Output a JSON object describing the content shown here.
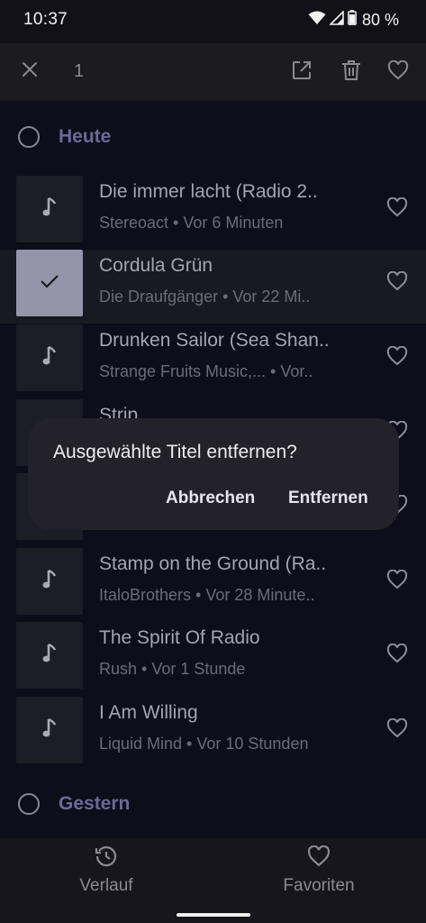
{
  "status_bar": {
    "time": "10:37",
    "battery": "80 %"
  },
  "top_bar": {
    "selected_count": "1",
    "actions": [
      "open-external-icon",
      "delete-icon",
      "heart-icon"
    ]
  },
  "sections": [
    {
      "label": "Heute"
    },
    {
      "label": "Gestern"
    }
  ],
  "tracks": [
    {
      "title": "Die immer lacht (Radio 2..",
      "subtitle": "Stereoact • Vor 6 Minuten",
      "selected": false
    },
    {
      "title": "Cordula Grün",
      "subtitle": "Die Draufgänger • Vor 22 Mi..",
      "selected": true
    },
    {
      "title": "Drunken Sailor (Sea Shan..",
      "subtitle": "Strange Fruits Music,... • Vor..",
      "selected": false
    },
    {
      "title": "Strip",
      "subtitle": "",
      "selected": false
    },
    {
      "title": "",
      "subtitle": "",
      "selected": false
    },
    {
      "title": "Stamp on the Ground (Ra..",
      "subtitle": "ItaloBrothers • Vor 28 Minute..",
      "selected": false
    },
    {
      "title": "The Spirit Of Radio",
      "subtitle": "Rush • Vor 1 Stunde",
      "selected": false
    },
    {
      "title": "I Am Willing",
      "subtitle": "Liquid Mind • Vor 10 Stunden",
      "selected": false
    }
  ],
  "dialog": {
    "title": "Ausgewählte Titel entfernen?",
    "cancel_label": "Abbrechen",
    "confirm_label": "Entfernen"
  },
  "bottom_nav": {
    "history_label": "Verlauf",
    "favorites_label": "Favoriten"
  }
}
